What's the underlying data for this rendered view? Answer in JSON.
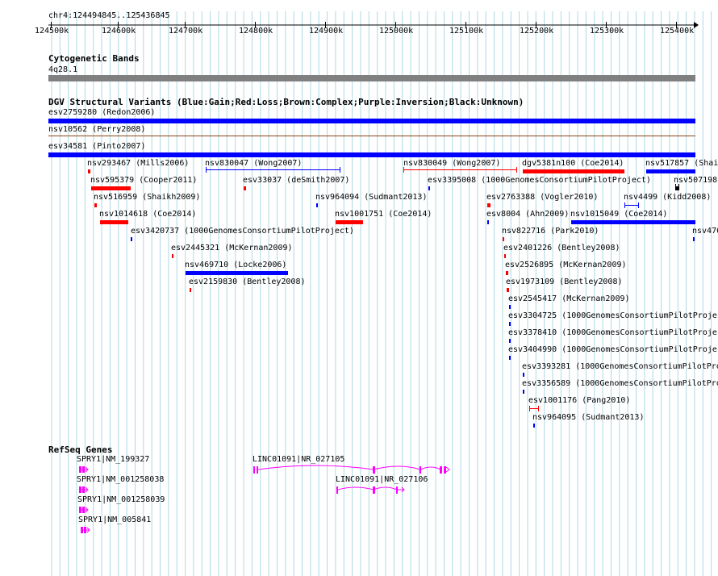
{
  "ruler": {
    "location": "chr4:124494845..125436845",
    "ticks": [
      "124500k",
      "124600k",
      "124700k",
      "124800k",
      "124900k",
      "125000k",
      "125100k",
      "125200k",
      "125300k",
      "125400k"
    ]
  },
  "cytoband": {
    "title": "Cytogenetic Bands",
    "band": "4q28.1"
  },
  "dgv": {
    "title": "DGV Structural Variants (Blue:Gain;Red:Loss;Brown:Complex;Purple:Inversion;Black:Unknown)",
    "features": [
      {
        "label": "esv2759280 (Redon2006)",
        "color": "#0000ff"
      },
      {
        "label": "nsv10562 (Perry2008)",
        "color": "#8b4513"
      },
      {
        "label": "esv34581 (Pinto2007)",
        "color": "#0000ff"
      },
      {
        "label": "nsv293467 (Mills2006)",
        "color": "#ff0000"
      },
      {
        "label": "nsv830047 (Wong2007)",
        "color": "#0000ff"
      },
      {
        "label": "nsv830049 (Wong2007)",
        "color": "#ff0000"
      },
      {
        "label": "dgv5381n100 (Coe2014)",
        "color": "#ff0000"
      },
      {
        "label": "nsv517857 (Shai",
        "color": "#0000ff"
      },
      {
        "label": "nsv595379 (Cooper2011)",
        "color": "#ff0000"
      },
      {
        "label": "esv33037 (deSmith2007)",
        "color": "#ff0000"
      },
      {
        "label": "esv3395008 (1000GenomesConsortiumPilotProject)",
        "color": "#0000ff"
      },
      {
        "label": "nsv507198",
        "color": "#000000"
      },
      {
        "label": "nsv516959 (Shaikh2009)",
        "color": "#ff0000"
      },
      {
        "label": "nsv964094 (Sudmant2013)",
        "color": "#0000ff"
      },
      {
        "label": "esv2763388 (Vogler2010)",
        "color": "#ff0000"
      },
      {
        "label": "nsv4499 (Kidd2008)",
        "color": "#0000ff"
      },
      {
        "label": "nsv1014618 (Coe2014)",
        "color": "#ff0000"
      },
      {
        "label": "nsv1001751 (Coe2014)",
        "color": "#ff0000"
      },
      {
        "label": "esv8004 (Ahn2009)",
        "color": "#0000ff"
      },
      {
        "label": "nsv1015049 (Coe2014)",
        "color": "#0000ff"
      },
      {
        "label": "esv3420737 (1000GenomesConsortiumPilotProject)",
        "color": "#0000ff"
      },
      {
        "label": "nsv822716 (Park2010)",
        "color": "#ff0000"
      },
      {
        "label": "nsv476",
        "color": "#0000ff"
      },
      {
        "label": "esv2445321 (McKernan2009)",
        "color": "#ff0000"
      },
      {
        "label": "esv2401226 (Bentley2008)",
        "color": "#ff0000"
      },
      {
        "label": "nsv469710 (Locke2006)",
        "color": "#0000ff"
      },
      {
        "label": "esv2526895 (McKernan2009)",
        "color": "#ff0000"
      },
      {
        "label": "esv2159830 (Bentley2008)",
        "color": "#ff0000"
      },
      {
        "label": "esv1973109 (Bentley2008)",
        "color": "#ff0000"
      },
      {
        "label": "esv2545417 (McKernan2009)",
        "color": "#0000ff"
      },
      {
        "label": "esv3304725 (1000GenomesConsortiumPilotProje",
        "color": "#0000ff"
      },
      {
        "label": "esv3378410 (1000GenomesConsortiumPilotProje",
        "color": "#0000ff"
      },
      {
        "label": "esv3404990 (1000GenomesConsortiumPilotProje",
        "color": "#0000ff"
      },
      {
        "label": "esv3393281 (1000GenomesConsortiumPilotProj",
        "color": "#0000ff"
      },
      {
        "label": "esv3356589 (1000GenomesConsortiumPilotProj",
        "color": "#0000ff"
      },
      {
        "label": "esv1001176 (Pang2010)",
        "color": "#ff0000"
      },
      {
        "label": "nsv964095 (Sudmant2013)",
        "color": "#0000ff"
      }
    ]
  },
  "refseq": {
    "title": "RefSeq Genes",
    "genes": [
      {
        "label": "SPRY1|NM_199327"
      },
      {
        "label": "SPRY1|NM_001258038"
      },
      {
        "label": "SPRY1|NM_001258039"
      },
      {
        "label": "SPRY1|NM_005841"
      },
      {
        "label": "LINC01091|NR_027105"
      },
      {
        "label": "LINC01091|NR_027106"
      }
    ],
    "color": "#ff00ff"
  },
  "colors": {
    "gain": "#0000ff",
    "loss": "#ff0000",
    "complex": "#8b4513",
    "gridline": "#add8e6",
    "band": "#808080",
    "gene": "#ff00ff"
  }
}
